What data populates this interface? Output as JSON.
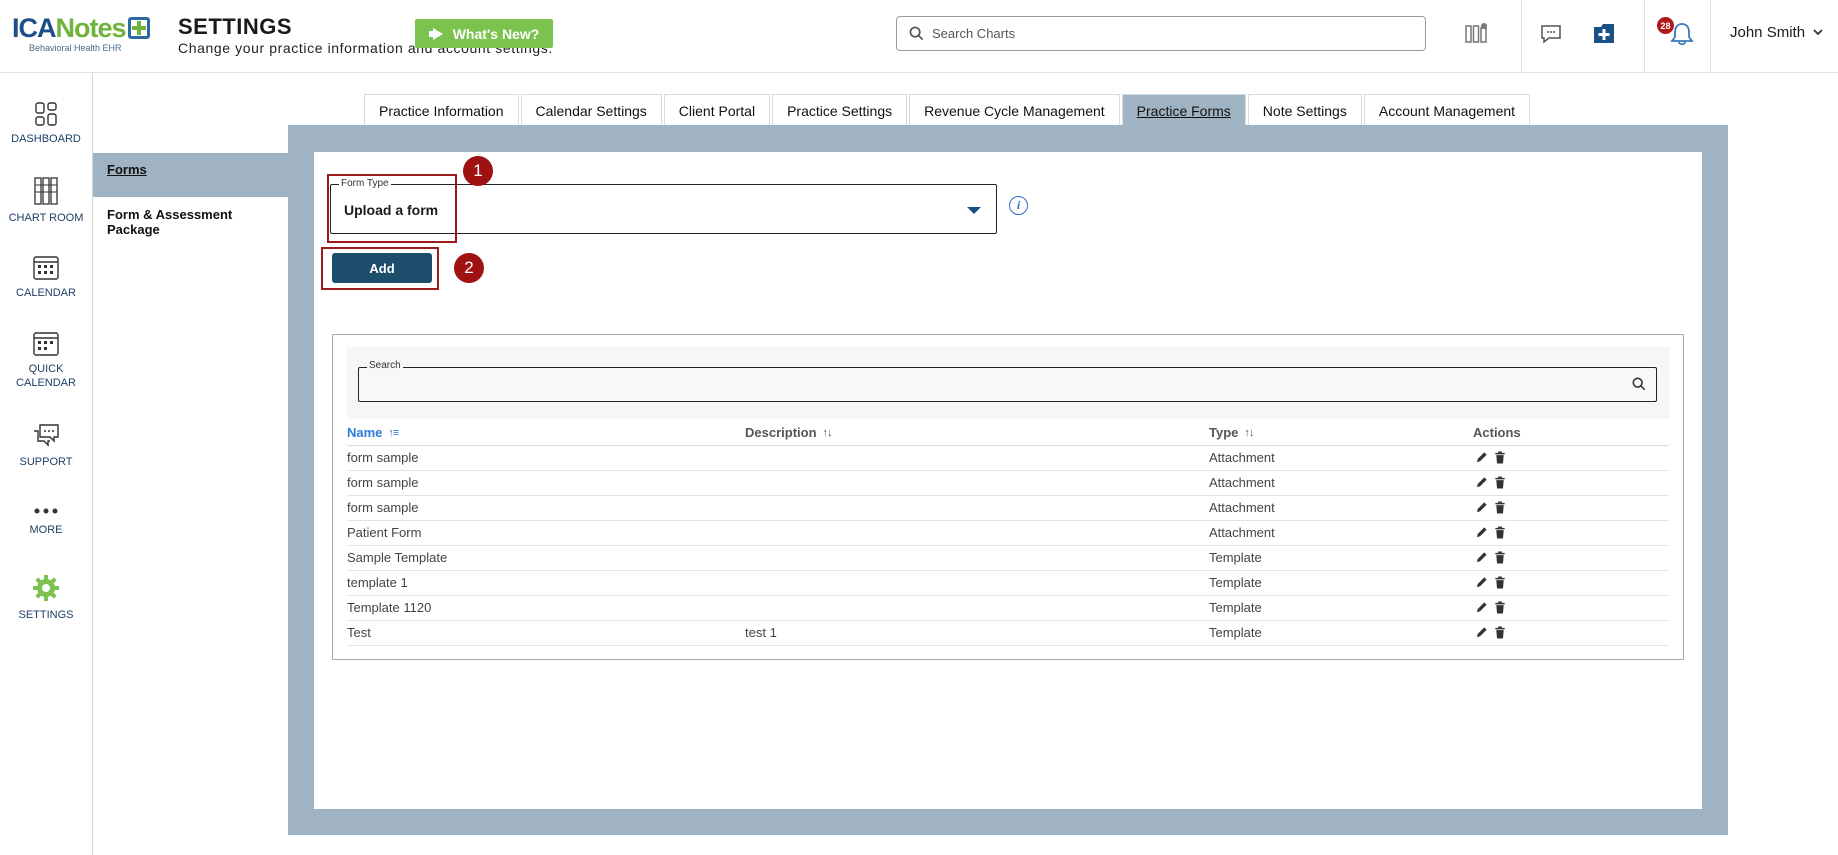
{
  "header": {
    "logo": {
      "brand_part1": "ICA",
      "brand_part2": "Notes",
      "subtitle": "Behavioral Health EHR"
    },
    "title": "SETTINGS",
    "subtitle": "Change your practice information and account settings.",
    "whats_new_label": "What's New?",
    "search_placeholder": "Search Charts",
    "notification_count": "28",
    "user_name": "John Smith"
  },
  "leftnav": {
    "items": [
      {
        "label": "DASHBOARD",
        "icon": "dashboard-icon"
      },
      {
        "label": "CHART ROOM",
        "icon": "chart-room-icon"
      },
      {
        "label": "CALENDAR",
        "icon": "calendar-icon"
      },
      {
        "label": "QUICK CALENDAR",
        "icon": "quick-calendar-icon"
      },
      {
        "label": "SUPPORT",
        "icon": "support-icon"
      },
      {
        "label": "MORE",
        "icon": "more-icon"
      },
      {
        "label": "SETTINGS",
        "icon": "gear-icon"
      }
    ]
  },
  "subnav": {
    "items": [
      "Forms",
      "Form & Assessment Package"
    ],
    "active": "Forms"
  },
  "tabs": {
    "items": [
      "Practice Information",
      "Calendar Settings",
      "Client Portal",
      "Practice Settings",
      "Revenue Cycle Management",
      "Practice Forms",
      "Note Settings",
      "Account Management"
    ],
    "active": "Practice Forms"
  },
  "form": {
    "type_label": "Form Type",
    "type_value": "Upload a form",
    "add_label": "Add",
    "markers": [
      "1",
      "2"
    ]
  },
  "table": {
    "search_label": "Search",
    "search_value": "",
    "columns": [
      "Name",
      "Description",
      "Type",
      "Actions"
    ],
    "rows": [
      {
        "name": "form sample",
        "description": "",
        "type": "Attachment"
      },
      {
        "name": "form sample",
        "description": "",
        "type": "Attachment"
      },
      {
        "name": "form sample",
        "description": "",
        "type": "Attachment"
      },
      {
        "name": "Patient Form",
        "description": "",
        "type": "Attachment"
      },
      {
        "name": "Sample Template",
        "description": "",
        "type": "Template"
      },
      {
        "name": "template 1",
        "description": "",
        "type": "Template"
      },
      {
        "name": "Template 1120",
        "description": "",
        "type": "Template"
      },
      {
        "name": "Test",
        "description": "test 1",
        "type": "Template"
      }
    ]
  },
  "colors": {
    "brand_blue": "#1d4f87",
    "brand_green": "#6fb33a",
    "panel_bg": "#9fb3c2",
    "add_button": "#1c4d6b",
    "highlight_red": "#9c1b1b",
    "link_blue": "#2f7ad6"
  }
}
